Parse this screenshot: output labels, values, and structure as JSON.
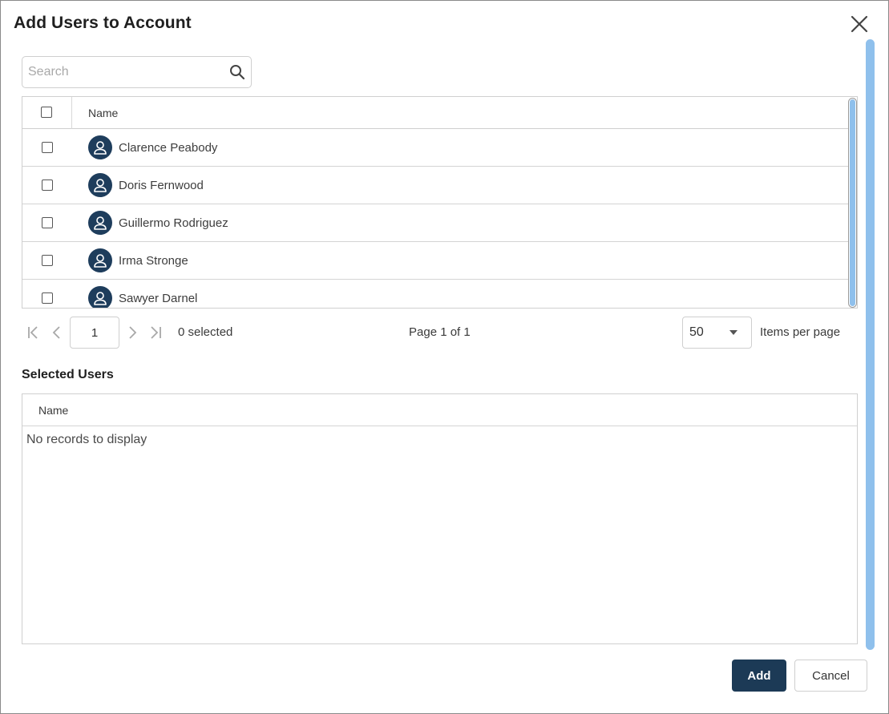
{
  "dialog": {
    "title": "Add Users to Account",
    "close_icon": "close-icon"
  },
  "search": {
    "placeholder": "Search",
    "value": "",
    "icon": "search-icon"
  },
  "users_grid": {
    "column_header": "Name",
    "rows": [
      {
        "name": "Clarence Peabody",
        "checked": false
      },
      {
        "name": "Doris Fernwood",
        "checked": false
      },
      {
        "name": "Guillermo Rodriguez",
        "checked": false
      },
      {
        "name": "Irma Stronge",
        "checked": false
      },
      {
        "name": "Sawyer Darnel",
        "checked": false
      }
    ]
  },
  "pager": {
    "current_page": "1",
    "selected_text": "0 selected",
    "page_info": "Page 1 of 1",
    "items_per_page": "50",
    "items_per_page_label": "Items per page"
  },
  "selected_users": {
    "title": "Selected Users",
    "column_header": "Name",
    "empty_text": "No records to display"
  },
  "footer": {
    "add_label": "Add",
    "cancel_label": "Cancel"
  },
  "colors": {
    "primary": "#1c3a56",
    "avatar": "#1e3d5c",
    "scrollbar": "#8fc0ec",
    "border": "#cfcfcf"
  }
}
